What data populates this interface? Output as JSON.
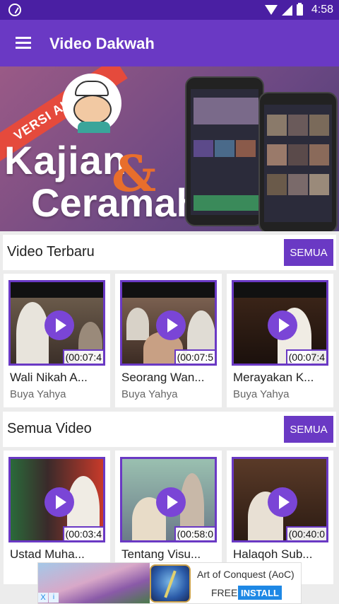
{
  "status_bar": {
    "time": "4:58"
  },
  "app_bar": {
    "title": "Video Dakwah"
  },
  "banner": {
    "ribbon": "VERSI AUDIO",
    "line1": "Kajian",
    "amp": "&",
    "line2": "Ceramah"
  },
  "sections": [
    {
      "title": "Video Terbaru",
      "button_label": "SEMUA",
      "videos": [
        {
          "title": "Wali Nikah A...",
          "author": "Buya Yahya",
          "duration": "(00:07:4"
        },
        {
          "title": "Seorang Wan...",
          "author": "Buya Yahya",
          "duration": "(00:07:5"
        },
        {
          "title": "Merayakan K...",
          "author": "Buya Yahya",
          "duration": "(00:07:4"
        }
      ]
    },
    {
      "title": "Semua Video",
      "button_label": "SEMUA",
      "videos": [
        {
          "title": "Ustad Muha...",
          "duration": "(00:03:4"
        },
        {
          "title": "Tentang Visu...",
          "duration": "(00:58:0"
        },
        {
          "title": "Halaqoh Sub...",
          "duration": "(00:40:0"
        }
      ]
    }
  ],
  "ad": {
    "title": "Art of Conquest (AoC)",
    "free_label": "FREE",
    "install_label": "INSTALL",
    "close_glyph": "X",
    "info_glyph": "i"
  },
  "colors": {
    "app_bar": "#6a39c4",
    "status_bar": "#4a1fa3",
    "accent": "#7a45d6",
    "ad_install": "#1e88e5"
  },
  "icons": [
    "menu-icon",
    "wifi-icon",
    "signal-icon",
    "battery-icon",
    "play-icon",
    "close-icon",
    "info-icon"
  ]
}
